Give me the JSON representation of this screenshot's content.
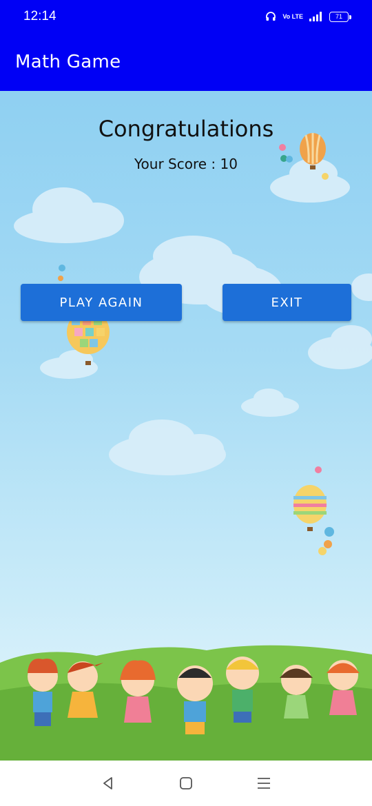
{
  "status": {
    "time": "12:14",
    "network_label": "Vo LTE",
    "battery": "71",
    "icons": [
      "headset-icon",
      "volte-icon",
      "signal-icon",
      "battery-icon"
    ]
  },
  "app": {
    "title": "Math Game",
    "bar_color": "#0000f5"
  },
  "result": {
    "heading": "Congratulations",
    "score_text": "Your Score : 10"
  },
  "actions": {
    "play_again": "PLAY AGAIN",
    "exit": "EXIT",
    "button_color": "#1d6fd8"
  },
  "navigation": {
    "icons": [
      "back-icon",
      "home-icon",
      "recents-icon"
    ]
  }
}
